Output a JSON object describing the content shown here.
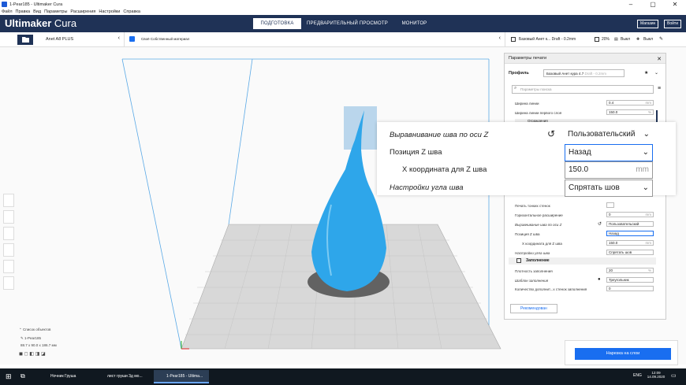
{
  "window": {
    "title": "1-Pear185 - Ultimaker Cura"
  },
  "menu": [
    "Файл",
    "Правка",
    "Вид",
    "Параметры",
    "Расширения",
    "Настройки",
    "Справка"
  ],
  "app": {
    "logo_bold": "Ultimaker",
    "logo_light": "Cura"
  },
  "stages": [
    "ПОДГОТОВКА",
    "ПРЕДВАРИТЕЛЬНЫЙ ПРОСМОТР",
    "МОНИТОР"
  ],
  "account": {
    "marketplace": "Магазин",
    "signin": "Войти"
  },
  "toolbar": {
    "printer": "Anet A8 PLUS",
    "material": "Своё Собственный материал",
    "profile_summary": "Базовый Анет к... Draft - 0.2mm",
    "infill": "20%",
    "support": "Выкл",
    "adhesion": "Выкл"
  },
  "panel": {
    "title": "Параметры печати",
    "profile_label": "Профиль",
    "profile_value": "Базовый Анет кура 4.7",
    "profile_hint": "Draft - 0.2mm",
    "search_placeholder": "Параметры поиска",
    "rows": [
      {
        "label": "Ширина линии",
        "value": "0.4",
        "unit": "mm"
      },
      {
        "label": "Ширина линии первого слоя",
        "value": "150.0",
        "unit": "%"
      },
      {
        "label": "Печать тонких стенок",
        "value": "",
        "unit": ""
      },
      {
        "label": "Горизонтальное расширение",
        "value": "0",
        "unit": "mm"
      },
      {
        "label": "Выравнивание шва по оси Z",
        "value": "Пользовательский",
        "unit": ""
      },
      {
        "label": "Позиция Z шва",
        "value": "Назад",
        "unit": ""
      },
      {
        "label": "X координата для Z шва",
        "value": "150.0",
        "unit": "mm"
      },
      {
        "label": "Настройки угла шва",
        "value": "Спрятать шов",
        "unit": ""
      }
    ],
    "section_walls": "Ограждения",
    "section_infill": "Заполнение",
    "infill_rows": [
      {
        "label": "Плотность заполнения",
        "value": "20",
        "unit": "%"
      },
      {
        "label": "Шаблон заполнения",
        "value": "Треугольник",
        "unit": ""
      },
      {
        "label": "Количество дополнит...х стенок заполнения",
        "value": "0",
        "unit": ""
      }
    ],
    "recommended_button": "Рекомендован"
  },
  "zoom": {
    "row1_label": "Выравнивание шва по оси Z",
    "row1_value": "Пользовательский",
    "row2_label": "Позиция Z шва",
    "row2_value": "Назад",
    "row3_label": "X координата для Z шва",
    "row3_value": "150.0",
    "row3_unit": "mm",
    "row4_label": "Настройки угла шва",
    "row4_value": "Спрятать шов"
  },
  "objects": {
    "header": "Список объектов",
    "item": "1-Pear185",
    "dims": "88.7 x 90.0 x 186.7 мм"
  },
  "slice_button": "Нарезка на слои",
  "taskbar": {
    "items": [
      "Ночник Груша",
      "лист груши 3д мо...",
      "1-Pear185 - Ultima..."
    ],
    "lang": "ENG",
    "time": "12:09",
    "date": "14.09.2020"
  }
}
